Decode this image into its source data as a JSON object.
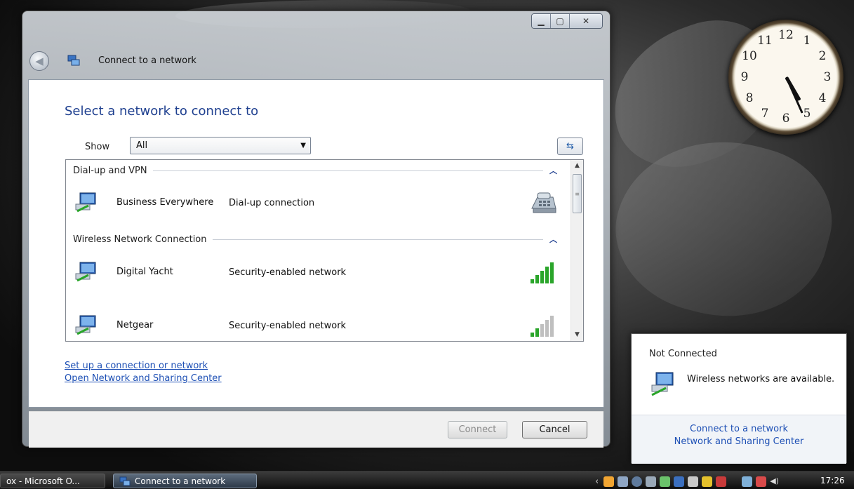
{
  "window": {
    "title": "Connect to a network",
    "heading": "Select a network to connect to",
    "show_label": "Show",
    "show_value": "All",
    "groups": [
      {
        "label": "Dial-up and VPN"
      },
      {
        "label": "Wireless Network Connection"
      }
    ],
    "networks": [
      {
        "name": "Business Everywhere",
        "type": "Dial-up connection",
        "signal_icon": "phone-icon"
      },
      {
        "name": "Digital Yacht",
        "type": "Security-enabled network",
        "signal_icon": "signal-strength-icon",
        "signal_bars": 5
      },
      {
        "name": "Netgear",
        "type": "Security-enabled network",
        "signal_icon": "signal-strength-icon",
        "signal_bars": 2
      }
    ],
    "links": {
      "setup": "Set up a connection or network",
      "sharing": "Open Network and Sharing Center"
    },
    "buttons": {
      "connect": "Connect",
      "cancel": "Cancel"
    }
  },
  "flyout": {
    "status": "Not Connected",
    "message": "Wireless networks are available.",
    "link_connect": "Connect to a network",
    "link_center": "Network and Sharing Center"
  },
  "taskbar": {
    "item1": "ox - Microsoft O...",
    "item2": "Connect to a network",
    "time": "17:26"
  },
  "colors": {
    "heading": "#1e3f8f",
    "link": "#1e50b5",
    "signal_active": "#2aa52a",
    "signal_inactive": "#bfbfbf"
  }
}
